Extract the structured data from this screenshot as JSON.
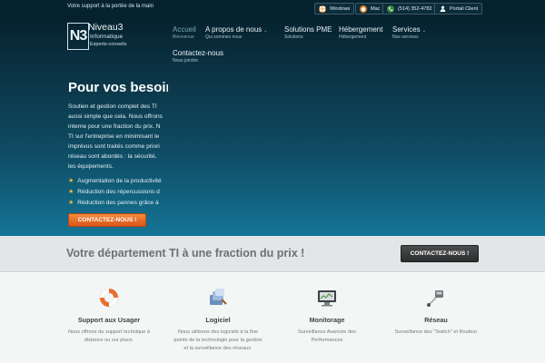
{
  "topbar": {
    "tagline": "Votre support à la portée de la main",
    "pills": [
      {
        "name": "windows-button",
        "icon": "windows-icon",
        "label": "Windows"
      },
      {
        "name": "mac-button",
        "icon": "apple-icon",
        "label": "Mac"
      },
      {
        "name": "phone-button",
        "icon": "phone-icon",
        "label": "(514) 352-4782"
      },
      {
        "name": "client-portal-button",
        "icon": "user-icon",
        "label": "Portail Client"
      }
    ]
  },
  "logo": {
    "mark": "N3",
    "name": "Niveau3",
    "line1": "Informatique",
    "line2": "Experts-conseils"
  },
  "nav": [
    {
      "label": "Accueil",
      "sub": "Bienvenue"
    },
    {
      "label": "A propos de nous",
      "sub": "Qui sommes nous"
    },
    {
      "label": "Solutions PME",
      "sub": "Solutions"
    },
    {
      "label": "Hébergement",
      "sub": "Hébergement"
    },
    {
      "label": "Services",
      "sub": "Nos services"
    },
    {
      "label": "Contactez-nous",
      "sub": "Nous joindre"
    }
  ],
  "hero": {
    "title": "Pour vos besoins",
    "paragraph": [
      "Soutien et gestion complet des TI",
      "aussi simple que cela. Nous offrons",
      "interne pour une fraction du prix. N",
      "TI sur l'entreprise en minimisant le",
      "imprévus sont traités comme priori",
      "réseau sont abordés : la sécurité,",
      "les équipements."
    ],
    "bullets": [
      "Augmentation de la productivité",
      "Réduction des répercussions d",
      "Réduction des pannes grâce à"
    ],
    "cta": "CONTACTEZ-NOUS !"
  },
  "band": {
    "headline": "Votre département TI à une fraction du prix !",
    "cta": "CONTACTEZ-NOUS !"
  },
  "features": [
    {
      "icon": "lifebuoy-icon",
      "title": "Support aux Usager",
      "desc": "Nous offrons du support technique à distance ou sur place."
    },
    {
      "icon": "software-icon",
      "title": "Logiciel",
      "desc": "Nous utilisons des logiciels à la fine pointe de la technologie pour la gestion et la surveillance des réseaux."
    },
    {
      "icon": "monitor-icon",
      "title": "Monitorage",
      "desc": "Surveillance Avancée des Performances"
    },
    {
      "icon": "network-icon",
      "title": "Réseau",
      "desc": "Surveillance des \"Switch\" et Routeur"
    }
  ],
  "colors": {
    "accent_orange": "#e8702a",
    "header_dark": "#06222f",
    "hero_teal": "#147596"
  }
}
